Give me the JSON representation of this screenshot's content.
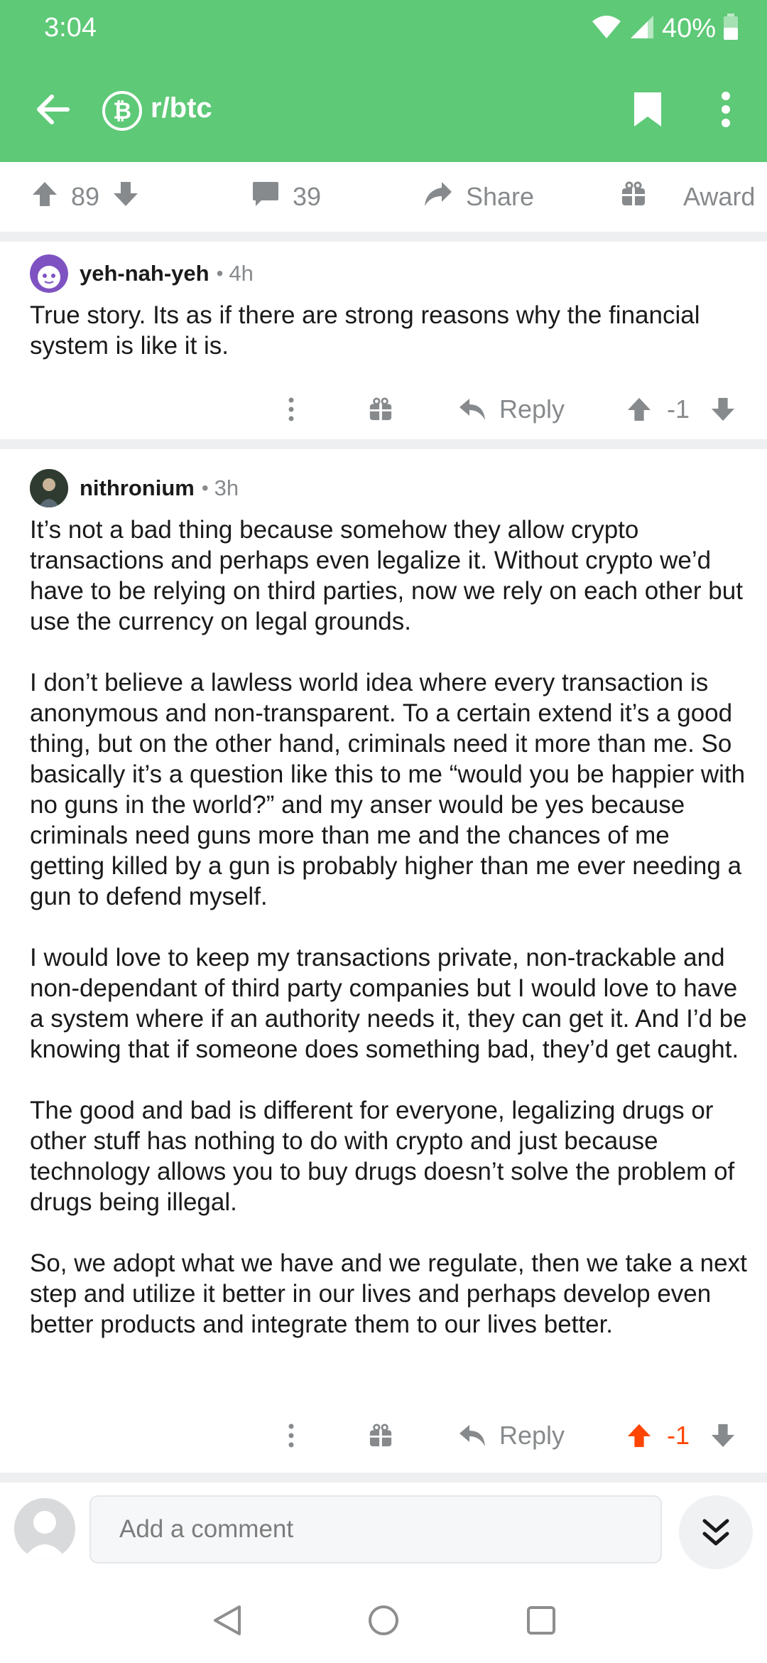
{
  "status": {
    "time": "3:04",
    "battery": "40%"
  },
  "app_bar": {
    "subreddit": "r/btc",
    "sub_icon_letter": "₿"
  },
  "post_actions": {
    "upvotes": "89",
    "comments": "39",
    "share": "Share",
    "award": "Award"
  },
  "comments": [
    {
      "author": "yeh-nah-yeh",
      "age": "4h",
      "body": [
        "True story. Its as if there are strong reasons why the financial system is like it is."
      ],
      "reply_label": "Reply",
      "score": "-1",
      "upvoted": false
    },
    {
      "author": "nithronium",
      "age": "3h",
      "body": [
        "It’s not a bad thing because somehow they allow crypto transactions and perhaps even legalize it. Without crypto we’d have to be relying on third parties, now we rely on each other but use the currency on legal grounds.",
        "I don’t believe a lawless world idea where every transaction is anonymous and non-transparent. To a certain extend it’s a good thing, but on the other hand, criminals need it more than me. So basically it’s a question like this to me “would you be happier with no guns in the world?” and my anser would be yes because criminals need guns more than me and the chances of me getting killed by a gun is probably higher than me ever needing a gun to defend myself.",
        "I would love to keep my transactions private, non-trackable and non-dependant of third party companies but I would love to have a system where if an authority needs it, they can get it. And I’d be knowing that if someone does something bad, they’d get caught.",
        "The good and bad is different for everyone, legalizing drugs or other stuff has nothing to do with crypto and just because technology allows you to buy drugs doesn’t solve the problem of drugs being illegal.",
        "So, we adopt what we have and we regulate, then we take a next step and utilize it better in our lives and perhaps develop even better products and integrate them to our lives better."
      ],
      "reply_label": "Reply",
      "score": "-1",
      "upvoted": true
    }
  ],
  "comment_bar": {
    "placeholder": "Add a comment"
  },
  "colors": {
    "header": "#5ec977",
    "upvote": "#ff4500",
    "muted": "#878a8c"
  },
  "icons": {
    "back": "back-arrow-icon",
    "bookmark": "bookmark-icon",
    "more": "more-vertical-icon",
    "upvote": "upvote-arrow-icon",
    "downvote": "downvote-arrow-icon",
    "comment": "comment-bubble-icon",
    "share": "share-arrow-icon",
    "award": "gift-icon",
    "reply": "reply-arrow-icon",
    "collapse": "double-chevron-down-icon"
  }
}
